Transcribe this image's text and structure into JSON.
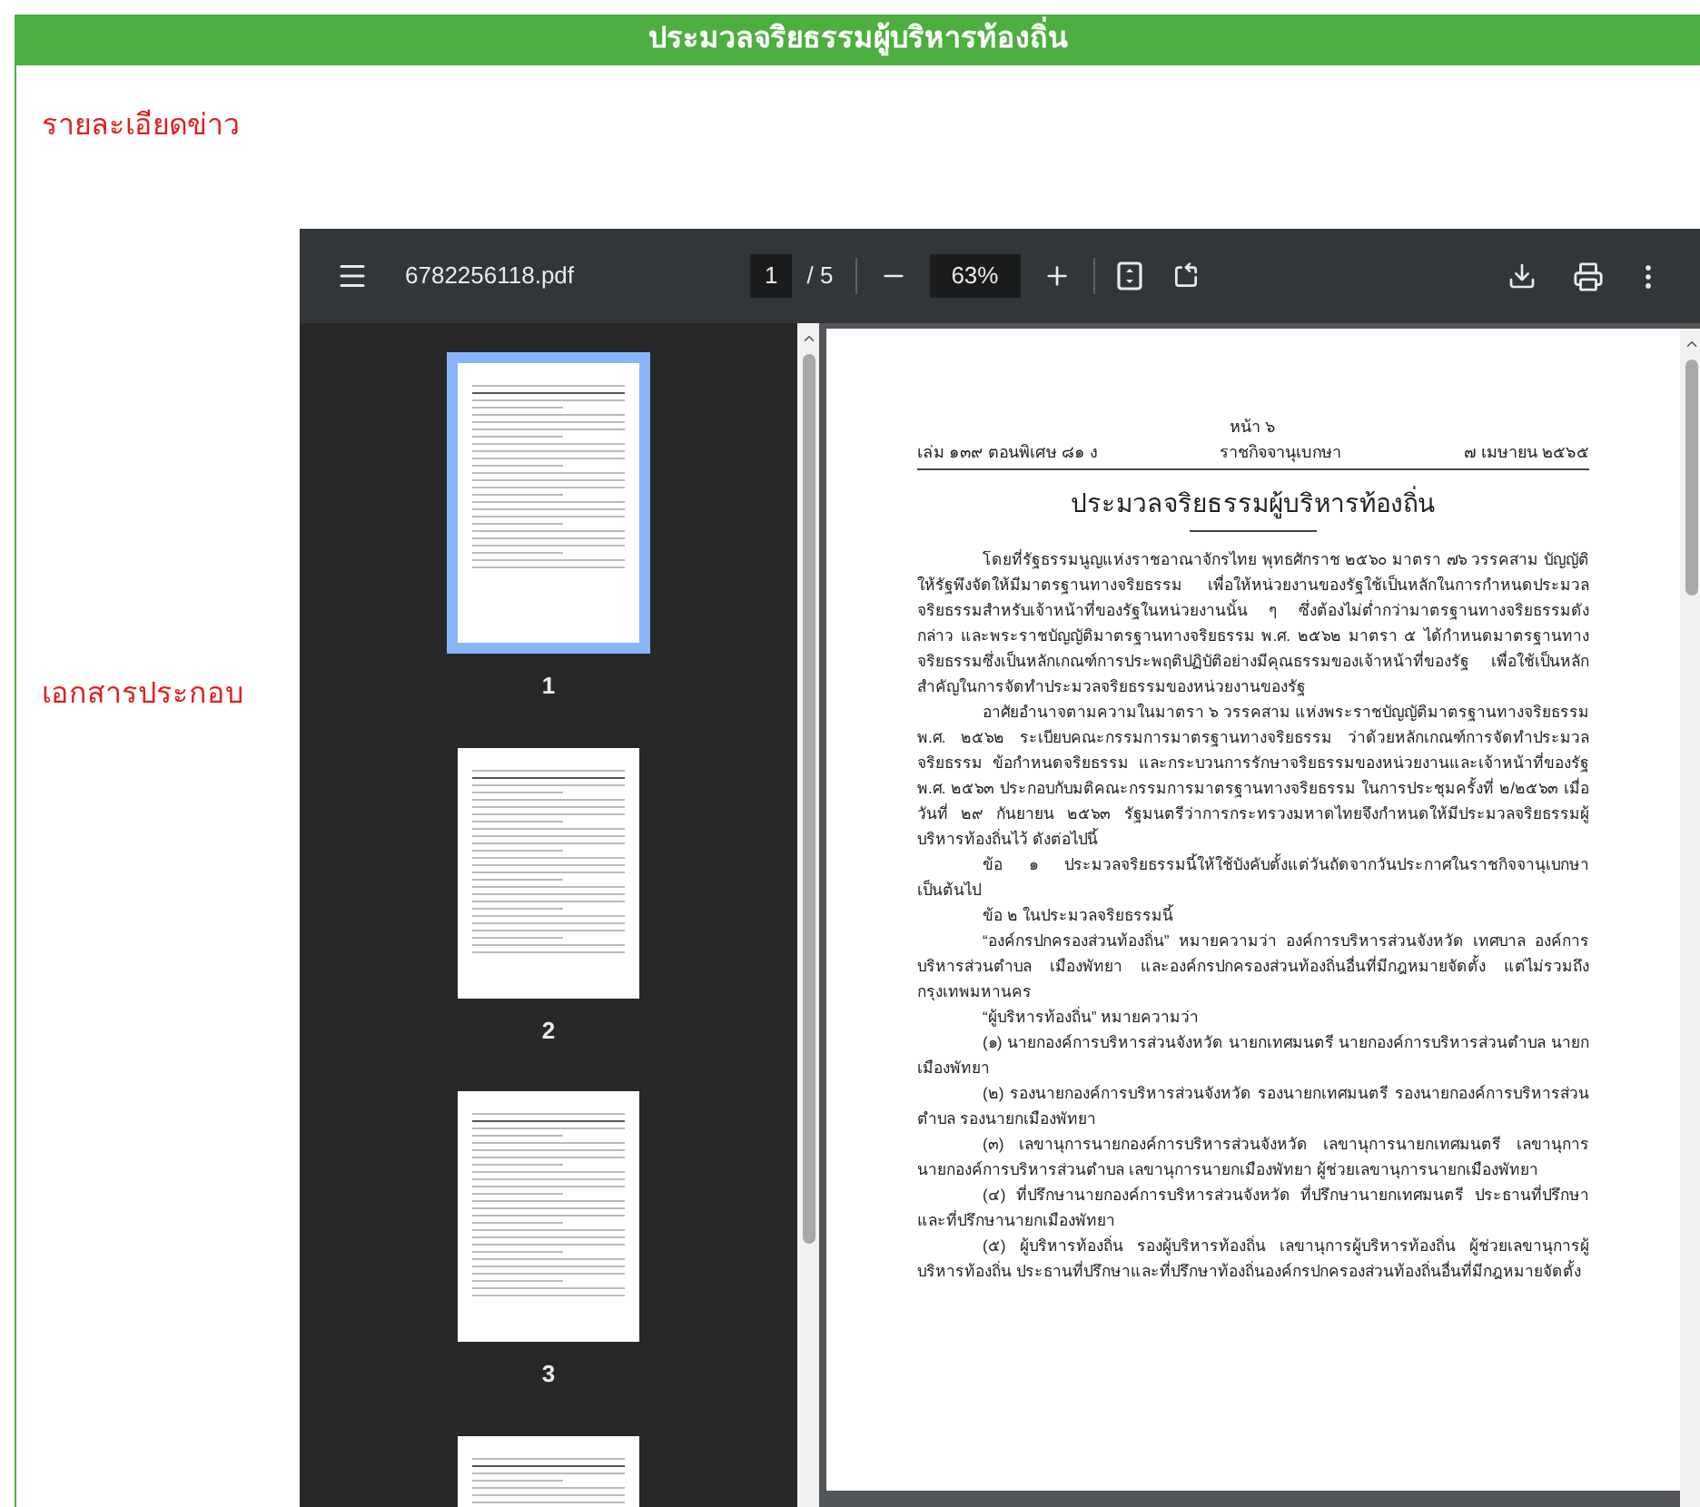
{
  "header": {
    "title": "ประมวลจริยธรรมผู้บริหารท้องถิ่น"
  },
  "news_label": "รายละเอียดข่าว",
  "attachment_label": "เอกสารประกอบ",
  "pdf_viewer": {
    "file_name": "6782256118.pdf",
    "page_input": "1",
    "page_total": "/ 5",
    "zoom": "63%",
    "thumbnails": [
      {
        "label": "1",
        "selected": true
      },
      {
        "label": "2",
        "selected": false
      },
      {
        "label": "3",
        "selected": false
      },
      {
        "selected": false
      }
    ],
    "page": {
      "page_number": "หน้า ๖",
      "volume": "เล่ม ๑๓๙ ตอนพิเศษ ๘๑ ง",
      "gazette": "ราชกิจจานุเบกษา",
      "date": "๗ เมษายน ๒๕๖๕",
      "title": "ประมวลจริยธรรมผู้บริหารท้องถิ่น",
      "paragraphs": [
        "โดยที่รัฐธรรมนูญแห่งราชอาณาจักรไทย พุทธศักราช ๒๕๖๐ มาตรา ๗๖ วรรคสาม บัญญัติให้รัฐพึงจัดให้มีมาตรฐานทางจริยธรรม เพื่อให้หน่วยงานของรัฐใช้เป็นหลักในการกำหนดประมวลจริยธรรมสำหรับเจ้าหน้าที่ของรัฐในหน่วยงานนั้น ๆ ซึ่งต้องไม่ต่ำกว่ามาตรฐานทางจริยธรรมดังกล่าว และพระราชบัญญัติมาตรฐานทางจริยธรรม พ.ศ. ๒๕๖๒ มาตรา ๕ ได้กำหนดมาตรฐานทางจริยธรรมซึ่งเป็นหลักเกณฑ์การประพฤติปฏิบัติอย่างมีคุณธรรมของเจ้าหน้าที่ของรัฐ เพื่อใช้เป็นหลักสำคัญในการจัดทำประมวลจริยธรรมของหน่วยงานของรัฐ",
        "อาศัยอำนาจตามความในมาตรา ๖ วรรคสาม แห่งพระราชบัญญัติมาตรฐานทางจริยธรรม พ.ศ. ๒๕๖๒ ระเบียบคณะกรรมการมาตรฐานทางจริยธรรม ว่าด้วยหลักเกณฑ์การจัดทำประมวลจริยธรรม ข้อกำหนดจริยธรรม และกระบวนการรักษาจริยธรรมของหน่วยงานและเจ้าหน้าที่ของรัฐ พ.ศ. ๒๕๖๓ ประกอบกับมติคณะกรรมการมาตรฐานทางจริยธรรม ในการประชุมครั้งที่ ๒/๒๕๖๓ เมื่อวันที่ ๒๙ กันยายน ๒๕๖๓ รัฐมนตรีว่าการกระทรวงมหาดไทยจึงกำหนดให้มีประมวลจริยธรรมผู้บริหารท้องถิ่นไว้ ดังต่อไปนี้",
        "ข้อ ๑ ประมวลจริยธรรมนี้ให้ใช้บังคับตั้งแต่วันถัดจากวันประกาศในราชกิจจานุเบกษาเป็นต้นไป",
        "ข้อ ๒ ในประมวลจริยธรรมนี้",
        "“องค์กรปกครองส่วนท้องถิ่น” หมายความว่า องค์การบริหารส่วนจังหวัด เทศบาล องค์การบริหารส่วนตำบล เมืองพัทยา และองค์กรปกครองส่วนท้องถิ่นอื่นที่มีกฎหมายจัดตั้ง แต่ไม่รวมถึงกรุงเทพมหานคร",
        "“ผู้บริหารท้องถิ่น” หมายความว่า",
        "(๑) นายกองค์การบริหารส่วนจังหวัด นายกเทศมนตรี นายกองค์การบริหารส่วนตำบล นายกเมืองพัทยา",
        "(๒) รองนายกองค์การบริหารส่วนจังหวัด รองนายกเทศมนตรี รองนายกองค์การบริหารส่วนตำบล รองนายกเมืองพัทยา",
        "(๓) เลขานุการนายกองค์การบริหารส่วนจังหวัด เลขานุการนายกเทศมนตรี เลขานุการนายกองค์การบริหารส่วนตำบล เลขานุการนายกเมืองพัทยา ผู้ช่วยเลขานุการนายกเมืองพัทยา",
        "(๔) ที่ปรึกษานายกองค์การบริหารส่วนจังหวัด ที่ปรึกษานายกเทศมนตรี ประธานที่ปรึกษาและที่ปรึกษานายกเมืองพัทยา",
        "(๕) ผู้บริหารท้องถิ่น รองผู้บริหารท้องถิ่น เลขานุการผู้บริหารท้องถิ่น ผู้ช่วยเลขานุการผู้บริหารท้องถิ่น ประธานที่ปรึกษาและที่ปรึกษาท้องถิ่นองค์กรปกครองส่วนท้องถิ่นอื่นที่มีกฎหมายจัดตั้ง"
      ]
    }
  }
}
